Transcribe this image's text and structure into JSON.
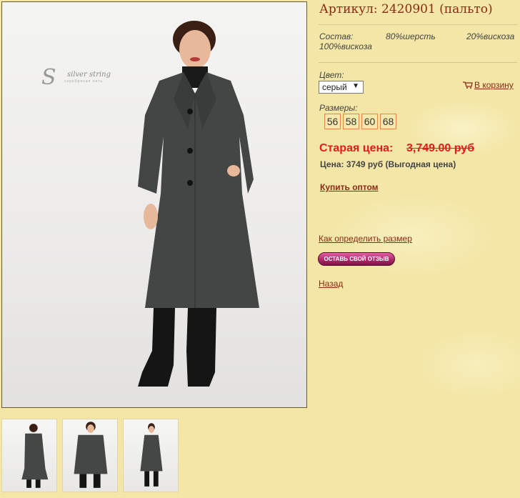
{
  "product": {
    "title": "Артикул: 2420901 (пальто)",
    "composition_label": "Состав:",
    "composition": [
      "80%шерсть",
      "20%вискоза",
      "100%вискоза"
    ],
    "color_label": "Цвет:",
    "color_selected": "серый",
    "add_to_cart": "В корзину",
    "sizes_label": "Размеры:",
    "sizes": [
      "56",
      "58",
      "60",
      "68"
    ],
    "old_price_label": "Старая цена:",
    "old_price_value": "3,749.00 руб",
    "price_line": "Цена: 3749 руб (Выгодная цена)",
    "wholesale_link": "Купить оптом",
    "size_help_link": "Как определить размер",
    "review_button": "ОСТАВЬ СВОЙ ОТЗЫВ",
    "back_link": "Назад"
  },
  "brand": {
    "logo_text": "silver string",
    "logo_sub": "серебряная нить"
  },
  "colors": {
    "accent": "#8b2a14",
    "old_price": "#e61c1c",
    "background": "#f3e6a6",
    "size_border": "#e08a3c"
  },
  "icons": [
    "cart-icon",
    "dropdown-arrow-icon"
  ]
}
